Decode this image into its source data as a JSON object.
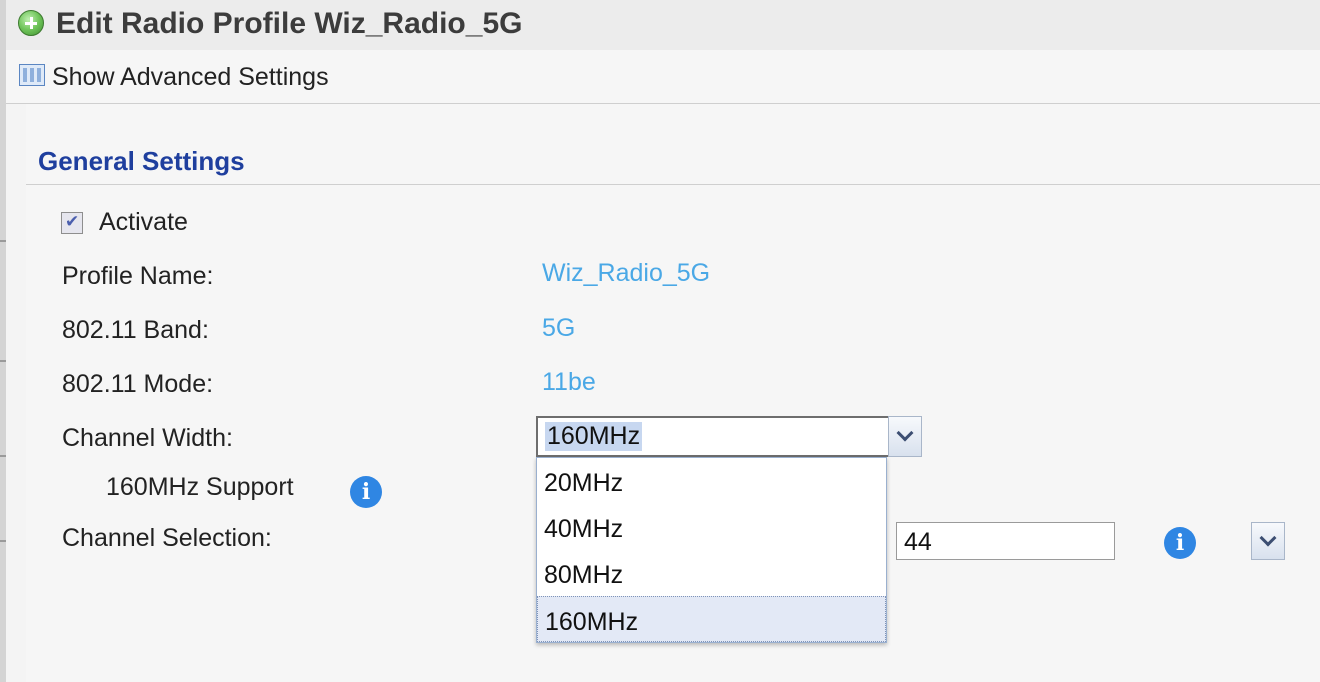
{
  "header": {
    "title": "Edit Radio Profile Wiz_Radio_5G",
    "icon": "add-circle-icon"
  },
  "toolbar": {
    "advanced_label": "Show Advanced Settings",
    "advanced_icon": "table-icon"
  },
  "section": {
    "title": "General Settings"
  },
  "form": {
    "activate_label": "Activate",
    "activate_checked": true,
    "profile_name_label": "Profile Name:",
    "profile_name_value": "Wiz_Radio_5G",
    "band_label": "802.11 Band:",
    "band_value": "5G",
    "mode_label": "802.11 Mode:",
    "mode_value": "11be",
    "channel_width_label": "Channel Width:",
    "channel_width_value": "160MHz",
    "channel_width_options": [
      "20MHz",
      "40MHz",
      "80MHz",
      "160MHz"
    ],
    "support_label": "160MHz Support",
    "channel_selection_label": "Channel Selection:",
    "channel_selection_value": "44"
  },
  "colors": {
    "title": "#1f3f9e",
    "value": "#4aa8e6",
    "info": "#2f86e3"
  }
}
